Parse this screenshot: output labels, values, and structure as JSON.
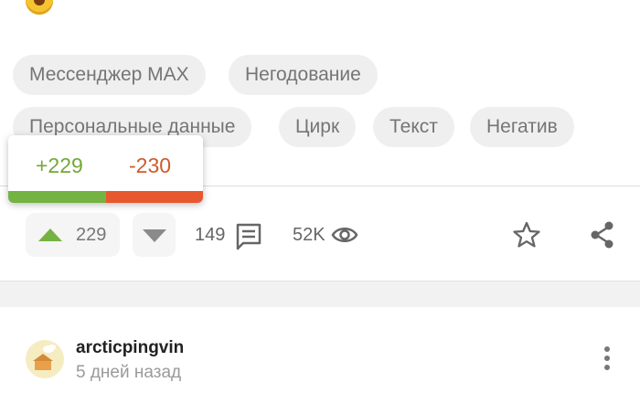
{
  "tags": [
    "Мессенджер MAX",
    "Негодование",
    "Персональные данные",
    "Цирк",
    "Текст",
    "Негатив"
  ],
  "rating_popup": {
    "plus": "+229",
    "minus": "-230",
    "plus_color": "#74b242",
    "minus_color": "#e8582f"
  },
  "actions": {
    "upvotes": "229",
    "comments": "149",
    "views": "52K"
  },
  "icons": [
    "rofl-emoji-icon",
    "arrow-up-icon",
    "arrow-down-icon",
    "comment-icon",
    "eye-icon",
    "star-icon",
    "share-icon",
    "more-vertical-icon"
  ],
  "comment": {
    "username": "arcticpingvin",
    "time": "5 дней назад"
  }
}
